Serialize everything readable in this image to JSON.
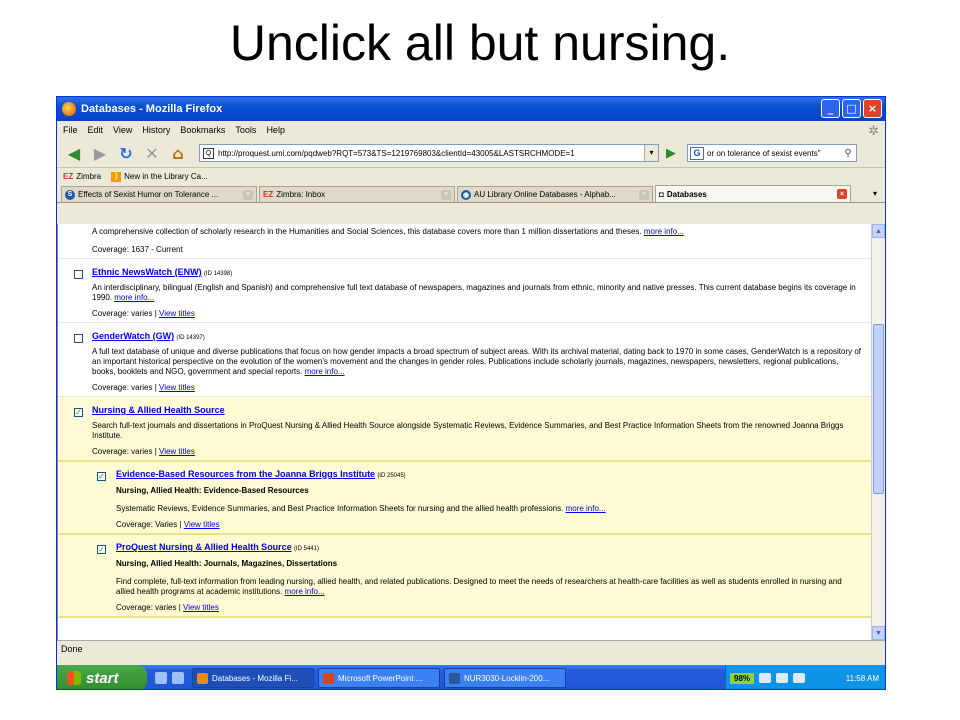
{
  "slide": {
    "title": "Unclick all but nursing."
  },
  "window": {
    "title": "Databases - Mozilla Firefox",
    "buttons": {
      "minimize": "_",
      "maximize": "□",
      "close": "×"
    }
  },
  "menu": [
    "File",
    "Edit",
    "View",
    "History",
    "Bookmarks",
    "Tools",
    "Help"
  ],
  "toolbar": {
    "url": "http://proquest.umi.com/pqdweb?RQT=573&TS=1219769803&clientId=43005&LASTSRCHMODE=1",
    "search_engine": "G",
    "search_value": "or on tolerance of sexist events\""
  },
  "bookmarks": [
    {
      "icon": "EZ",
      "label": "Zimbra"
    },
    {
      "icon": "rss",
      "label": "New in the Library Ca..."
    }
  ],
  "tabs": [
    {
      "label": "Effects of Sexist Humor on Tolerance ...",
      "icon": "S"
    },
    {
      "label": "Zimbra: Inbox",
      "icon": "EZ"
    },
    {
      "label": "",
      "icon": ""
    },
    {
      "label": "AU Library Online Databases - Alphab...",
      "icon": "globe"
    },
    {
      "label": "Databases",
      "icon": "proquest"
    }
  ],
  "content": {
    "top_desc": "A comprehensive collection of scholarly research in the Humanities and Social Sciences, this database covers more than 1 million dissertations and theses.",
    "top_more": "more info...",
    "top_coverage": "Coverage: 1637 - Current",
    "entries": [
      {
        "name": "Ethnic NewsWatch (ENW)",
        "id": "(ID 14398)",
        "checked": false,
        "desc": "An interdisciplinary, bilingual (English and Spanish) and comprehensive full text database of newspapers, magazines and journals from ethnic, minority and native presses. This current database begins its coverage in 1990.",
        "more": "more info...",
        "coverage": "Coverage: varies",
        "view_titles": "View titles"
      },
      {
        "name": "GenderWatch (GW)",
        "id": "(ID 14397)",
        "checked": false,
        "desc": "A full text database of unique and diverse publications that focus on how gender impacts a broad spectrum of subject areas. With its archival material, dating back to 1970 in some cases, GenderWatch is a repository of an important historical perspective on the evolution of the women's movement and the changes in gender roles. Publications include scholarly journals, magazines, newspapers, newsletters, regional publications, books, booklets and NGO, government and special reports.",
        "more": "more info...",
        "coverage": "Coverage: varies",
        "view_titles": "View titles"
      },
      {
        "name": "Nursing & Allied Health Source",
        "id": "",
        "checked": true,
        "desc": "Search full-text journals and dissertations in ProQuest Nursing & Allied Health Source alongside Systematic Reviews, Evidence Summaries, and Best Practice Information Sheets from the renowned Joanna Briggs Institute.",
        "more": "",
        "coverage": "Coverage: varies",
        "view_titles": "View titles"
      },
      {
        "name": "Evidence-Based Resources from the Joanna Briggs Institute",
        "id": "(ID 25045)",
        "checked": true,
        "category": "Nursing, Allied Health: Evidence-Based Resources",
        "desc": "Systematic Reviews, Evidence Summaries, and Best Practice Information Sheets for nursing and the allied health professions.",
        "more": "more info...",
        "coverage": "Coverage: Varies",
        "view_titles": "View titles"
      },
      {
        "name": "ProQuest Nursing & Allied Health Source",
        "id": "(ID 5441)",
        "checked": true,
        "category": "Nursing, Allied Health: Journals, Magazines, Dissertations",
        "desc": "Find complete, full-text information from leading nursing, allied health, and related publications. Designed to meet the needs of researchers at health-care facilities as well as students enrolled in nursing and allied health programs at academic institutions.",
        "more": "more info...",
        "coverage": "Coverage: varies",
        "view_titles": "View titles"
      }
    ]
  },
  "status": "Done",
  "taskbar": {
    "start": "start",
    "tasks": [
      {
        "label": "Databases - Mozilla Fi...",
        "active": true,
        "color": "#e8891c"
      },
      {
        "label": "Microsoft PowerPoint ...",
        "active": false,
        "color": "#d24726"
      },
      {
        "label": "NUR3030-Locklin-200...",
        "active": false,
        "color": "#2b5797"
      }
    ],
    "battery": "98%",
    "clock": "11:58 AM"
  }
}
